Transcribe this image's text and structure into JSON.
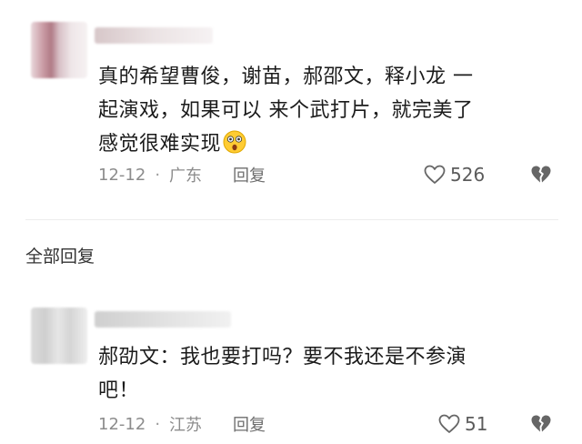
{
  "comments": [
    {
      "text_lines": [
        "真的希望曹俊，谢苗，郝邵文，释小龙 一",
        "起演戏，如果可以 来个武打片，就完美了",
        "感觉很难实现"
      ],
      "emoji": "astonished-face-emoji",
      "date": "12-12",
      "location": "广东",
      "reply_label": "回复",
      "likes": "526"
    },
    {
      "text_lines": [
        "郝劭文：我也要打吗？要不我还是不参演",
        "吧！"
      ],
      "date": "12-12",
      "location": "江苏",
      "reply_label": "回复",
      "likes": "51"
    }
  ],
  "section": {
    "all_replies_label": "全部回复"
  },
  "icons": {
    "like": "heart-outline-icon",
    "dislike": "broken-heart-icon"
  },
  "colors": {
    "text": "#1b1b1b",
    "meta": "#8c8c8c",
    "icon": "#666666"
  }
}
